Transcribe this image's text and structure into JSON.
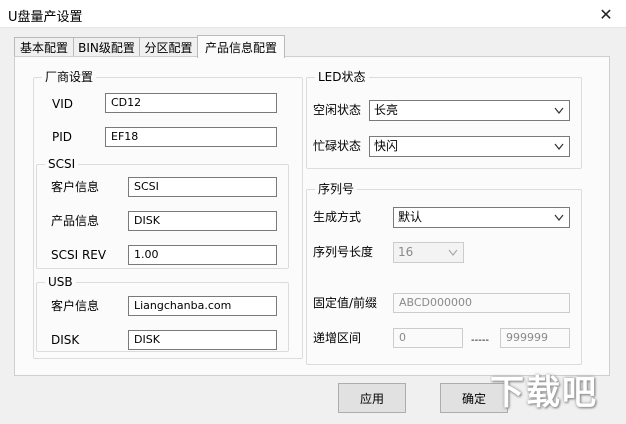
{
  "window": {
    "title": "U盘量产设置",
    "close_glyph": "✕"
  },
  "tabs": [
    {
      "label": "基本配置"
    },
    {
      "label": "BIN级配置"
    },
    {
      "label": "分区配置"
    },
    {
      "label": "产品信息配置"
    }
  ],
  "vendor": {
    "group_label": "厂商设置",
    "vid_label": "VID",
    "vid_value": "CD12",
    "pid_label": "PID",
    "pid_value": "EF18",
    "scsi": {
      "group_label": "SCSI",
      "customer_label": "客户信息",
      "customer_value": "SCSI",
      "product_label": "产品信息",
      "product_value": "DISK",
      "rev_label": "SCSI REV",
      "rev_value": "1.00"
    },
    "usb": {
      "group_label": "USB",
      "customer_label": "客户信息",
      "customer_value": "Liangchanba.com",
      "product_label": "产品信息",
      "product_value": "DISK"
    }
  },
  "led": {
    "group_label": "LED状态",
    "idle_label": "空闲状态",
    "idle_value": "长亮",
    "busy_label": "忙碌状态",
    "busy_value": "快闪"
  },
  "serial": {
    "group_label": "序列号",
    "mode_label": "生成方式",
    "mode_value": "默认",
    "length_label": "序列号长度",
    "length_value": "16",
    "prefix_label": "固定值/前缀",
    "prefix_value": "ABCD000000",
    "range_label": "递增区间",
    "range_from": "0",
    "range_sep": "-----",
    "range_to": "999999"
  },
  "buttons": {
    "apply": "应用",
    "ok": "确定"
  },
  "watermark": {
    "text": "下载吧"
  },
  "colors": {
    "panel_bg": "#fbfbfb",
    "window_bg": "#f0f0f0",
    "field_border": "#7a7a7a"
  }
}
